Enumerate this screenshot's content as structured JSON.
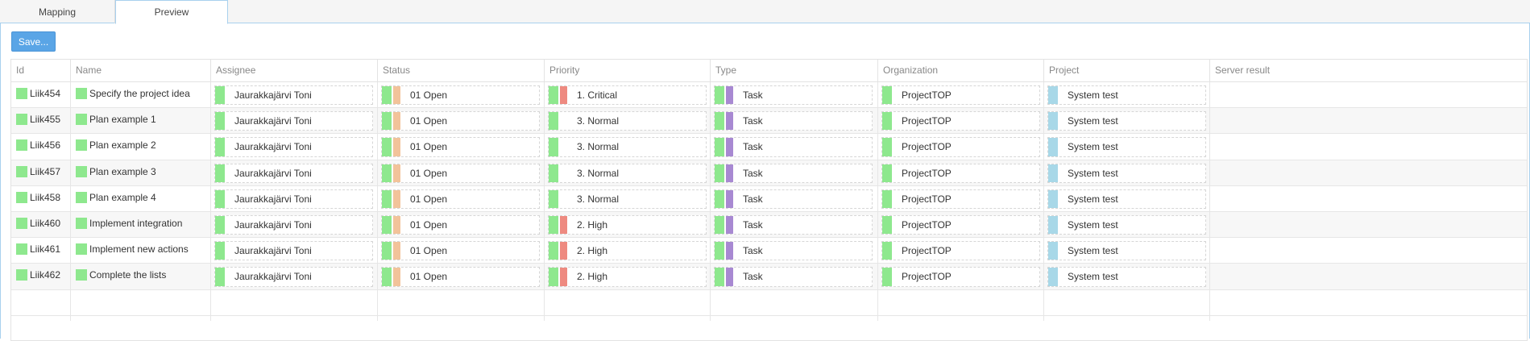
{
  "tabs": [
    {
      "label": "Mapping"
    },
    {
      "label": "Preview"
    }
  ],
  "toolbar": {
    "save_label": "Save..."
  },
  "colors": {
    "green": "#8ee88e",
    "orange": "#f2c39a",
    "red": "#ee8a80",
    "purple": "#a889d2",
    "light_blue": "#a8d8e8",
    "button_blue": "#5aa5e6"
  },
  "columns": [
    "Id",
    "Name",
    "Assignee",
    "Status",
    "Priority",
    "Type",
    "Organization",
    "Project",
    "Server result"
  ],
  "rows": [
    {
      "id": "Liik454",
      "name": "Specify the project idea",
      "assignee": "Jaurakkajärvi Toni",
      "status": "01 Open",
      "priority": "1. Critical",
      "priority_color": "red",
      "type": "Task",
      "organization": "ProjectTOP",
      "project": "System test",
      "server_result": ""
    },
    {
      "id": "Liik455",
      "name": "Plan example 1",
      "assignee": "Jaurakkajärvi Toni",
      "status": "01 Open",
      "priority": "3. Normal",
      "priority_color": "",
      "type": "Task",
      "organization": "ProjectTOP",
      "project": "System test",
      "server_result": ""
    },
    {
      "id": "Liik456",
      "name": "Plan example 2",
      "assignee": "Jaurakkajärvi Toni",
      "status": "01 Open",
      "priority": "3. Normal",
      "priority_color": "",
      "type": "Task",
      "organization": "ProjectTOP",
      "project": "System test",
      "server_result": ""
    },
    {
      "id": "Liik457",
      "name": "Plan example 3",
      "assignee": "Jaurakkajärvi Toni",
      "status": "01 Open",
      "priority": "3. Normal",
      "priority_color": "",
      "type": "Task",
      "organization": "ProjectTOP",
      "project": "System test",
      "server_result": ""
    },
    {
      "id": "Liik458",
      "name": "Plan example 4",
      "assignee": "Jaurakkajärvi Toni",
      "status": "01 Open",
      "priority": "3. Normal",
      "priority_color": "",
      "type": "Task",
      "organization": "ProjectTOP",
      "project": "System test",
      "server_result": ""
    },
    {
      "id": "Liik460",
      "name": "Implement integration",
      "assignee": "Jaurakkajärvi Toni",
      "status": "01 Open",
      "priority": "2. High",
      "priority_color": "red",
      "type": "Task",
      "organization": "ProjectTOP",
      "project": "System test",
      "server_result": ""
    },
    {
      "id": "Liik461",
      "name": "Implement new actions",
      "assignee": "Jaurakkajärvi Toni",
      "status": "01 Open",
      "priority": "2. High",
      "priority_color": "red",
      "type": "Task",
      "organization": "ProjectTOP",
      "project": "System test",
      "server_result": ""
    },
    {
      "id": "Liik462",
      "name": "Complete the lists",
      "assignee": "Jaurakkajärvi Toni",
      "status": "01 Open",
      "priority": "2. High",
      "priority_color": "red",
      "type": "Task",
      "organization": "ProjectTOP",
      "project": "System test",
      "server_result": ""
    }
  ]
}
